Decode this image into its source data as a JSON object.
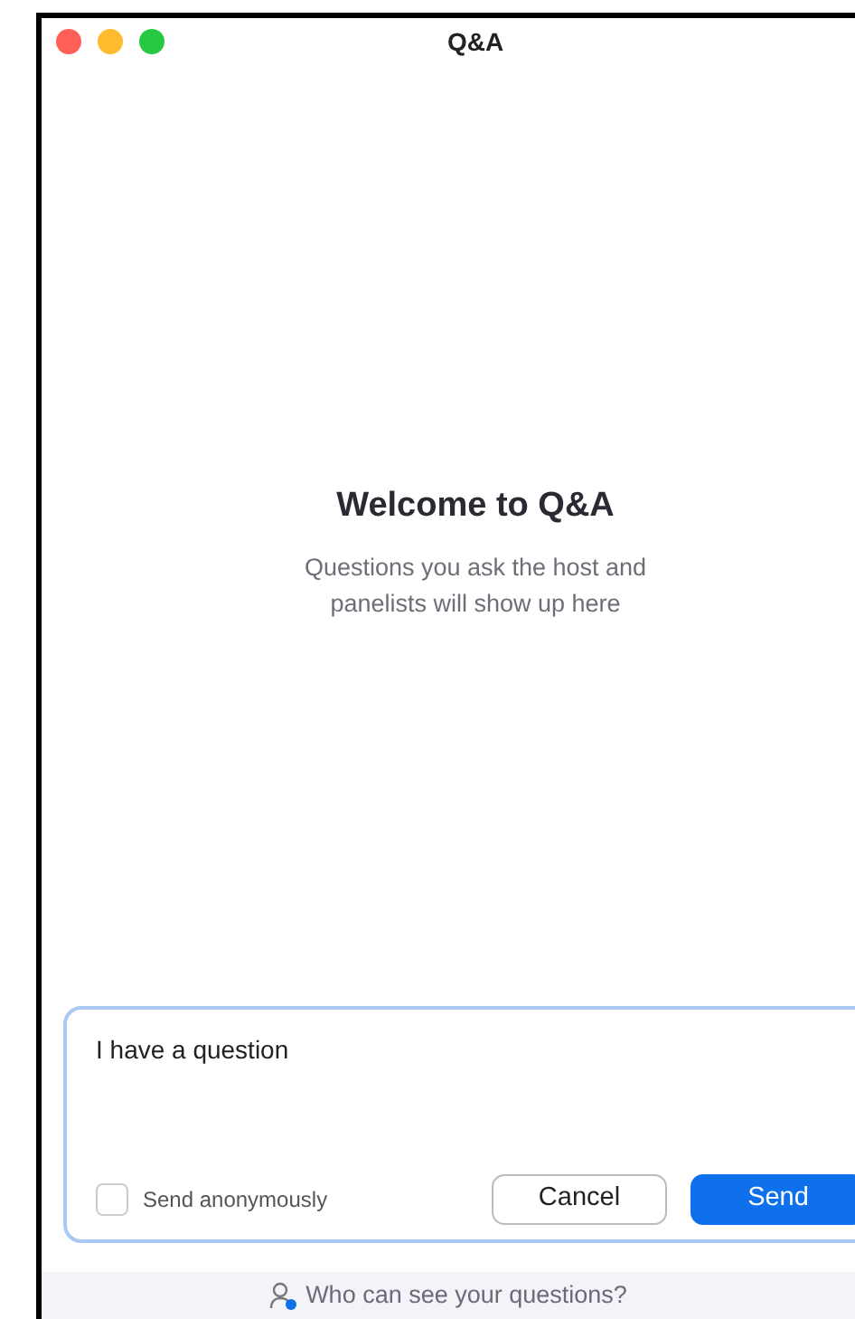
{
  "window": {
    "title": "Q&A"
  },
  "welcome": {
    "title": "Welcome to Q&A",
    "subtitle": "Questions you ask the host and panelists will show up here"
  },
  "composer": {
    "value": "I have a question",
    "anonymous": {
      "label": "Send anonymously",
      "checked": false
    },
    "buttons": [
      {
        "label": "Cancel",
        "kind": "secondary"
      },
      {
        "label": "Send",
        "kind": "primary"
      }
    ]
  },
  "footer": {
    "link": "Who can see your questions?"
  }
}
